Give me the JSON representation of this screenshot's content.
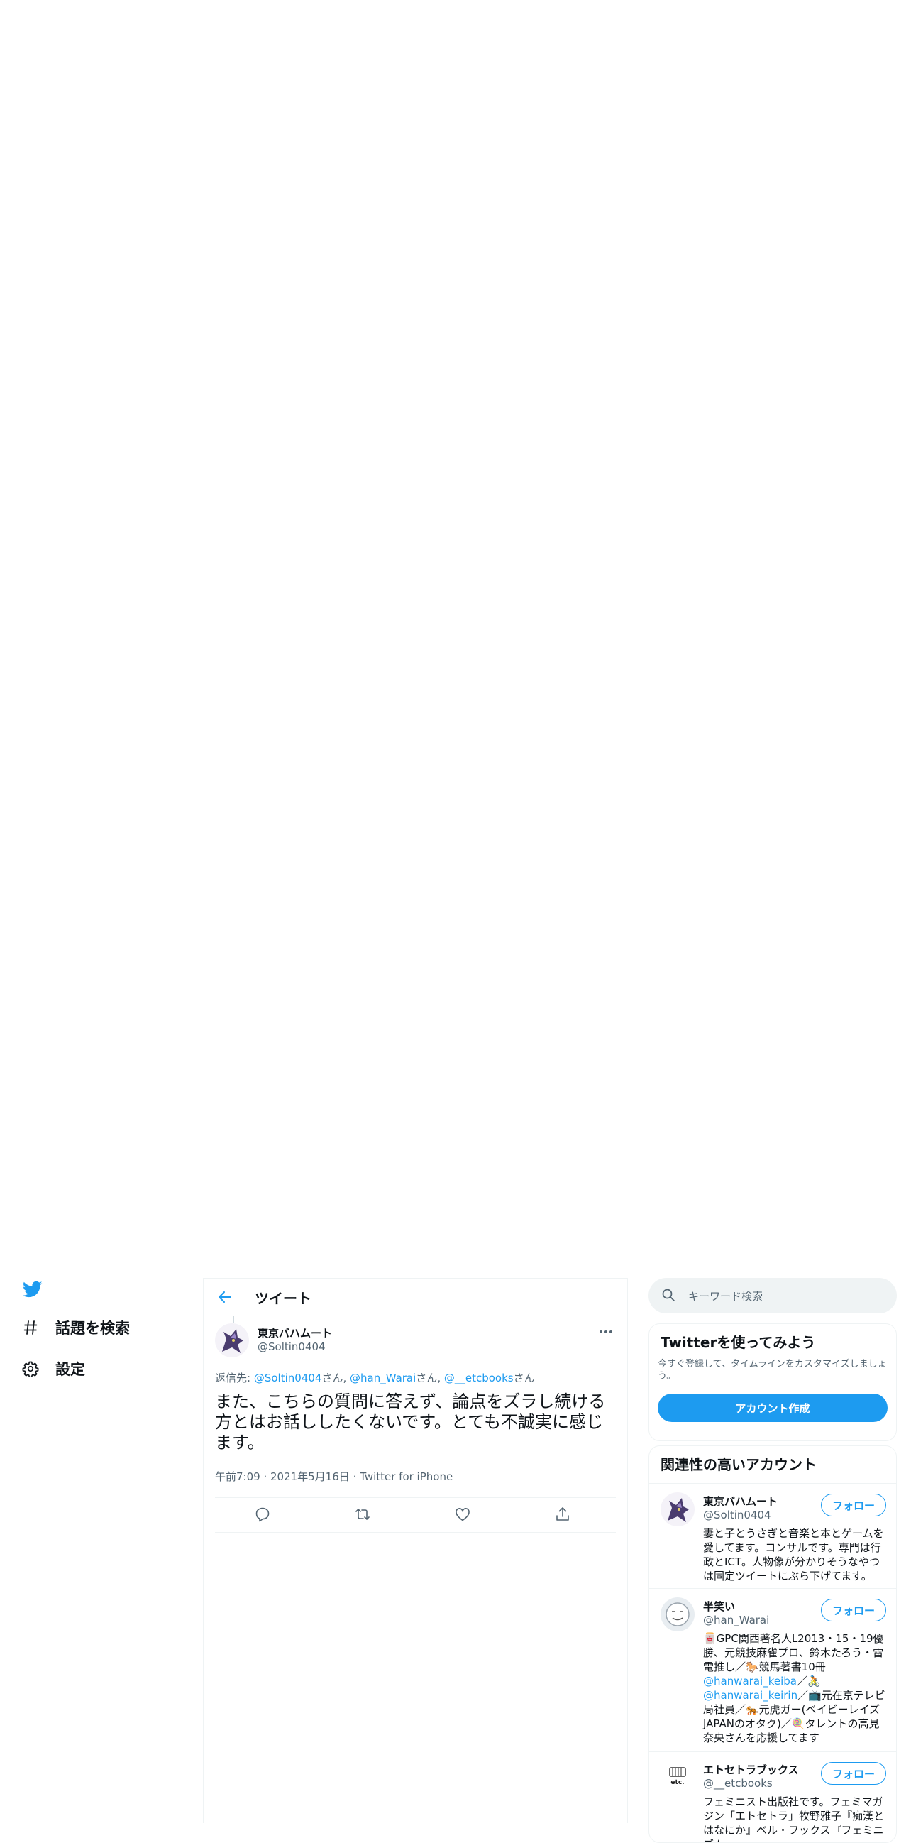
{
  "nav": {
    "items": [
      {
        "label": "話題を検索",
        "icon": "hashtag-icon"
      },
      {
        "label": "設定",
        "icon": "gear-icon"
      }
    ]
  },
  "header": {
    "title": "ツイート"
  },
  "tweet": {
    "name": "東京バハムート",
    "handle": "@Soltin0404",
    "reply_prefix": "返信先: ",
    "mentions": [
      "@Soltin0404",
      "@han_Warai",
      "@__etcbooks"
    ],
    "mention_suffix": "さん",
    "separator": ", ",
    "text": "また、こちらの質問に答えず、論点をズラし続ける方とはお話ししたくないです。とても不誠実に感じます。",
    "time": "午前7:09",
    "date": "2021年5月16日",
    "source": "Twitter for iPhone",
    "dot": " · "
  },
  "search": {
    "placeholder": "キーワード検索"
  },
  "signup": {
    "title": "Twitterを使ってみよう",
    "desc": "今すぐ登録して、タイムラインをカスタマイズしましょう。",
    "button": "アカウント作成"
  },
  "related": {
    "title": "関連性の高いアカウント",
    "follow_label": "フォロー",
    "accounts": [
      {
        "name": "東京バハムート",
        "handle": "@Soltin0404",
        "bio": "妻と子とうさぎと音楽と本とゲームを愛してます。コンサルです。専門は行政とICT。人物像が分かりそうなやつは固定ツイートにぶら下げてます。"
      },
      {
        "name": "半笑い",
        "handle": "@han_Warai",
        "bio_1": "🀄GPC関西著名人L2013・15・19優勝、元競技麻雀プロ、鈴木たろう・雷電推し／🐎競馬著書10冊",
        "bio_link_1": "@hanwarai_keiba",
        "bio_2": "／🚴",
        "bio_link_2": "@hanwarai_keirin",
        "bio_3": "／📺元在京テレビ局社員／🐅元虎ガー(ベイビーレイズJAPANのオタク)／🍭タレントの高見奈央さんを応援してます"
      },
      {
        "name": "エトセトラブックス",
        "handle": "@__etcbooks",
        "bio": "フェミニスト出版社です。フェミマガジン「エトセトラ」牧野雅子『痴漢とはなにか』ベル・フックス『フェミニズム"
      }
    ]
  },
  "colors": {
    "accent": "#1d9bf0",
    "text": "#0f1419",
    "muted": "#536471",
    "border": "#eff3f4"
  }
}
